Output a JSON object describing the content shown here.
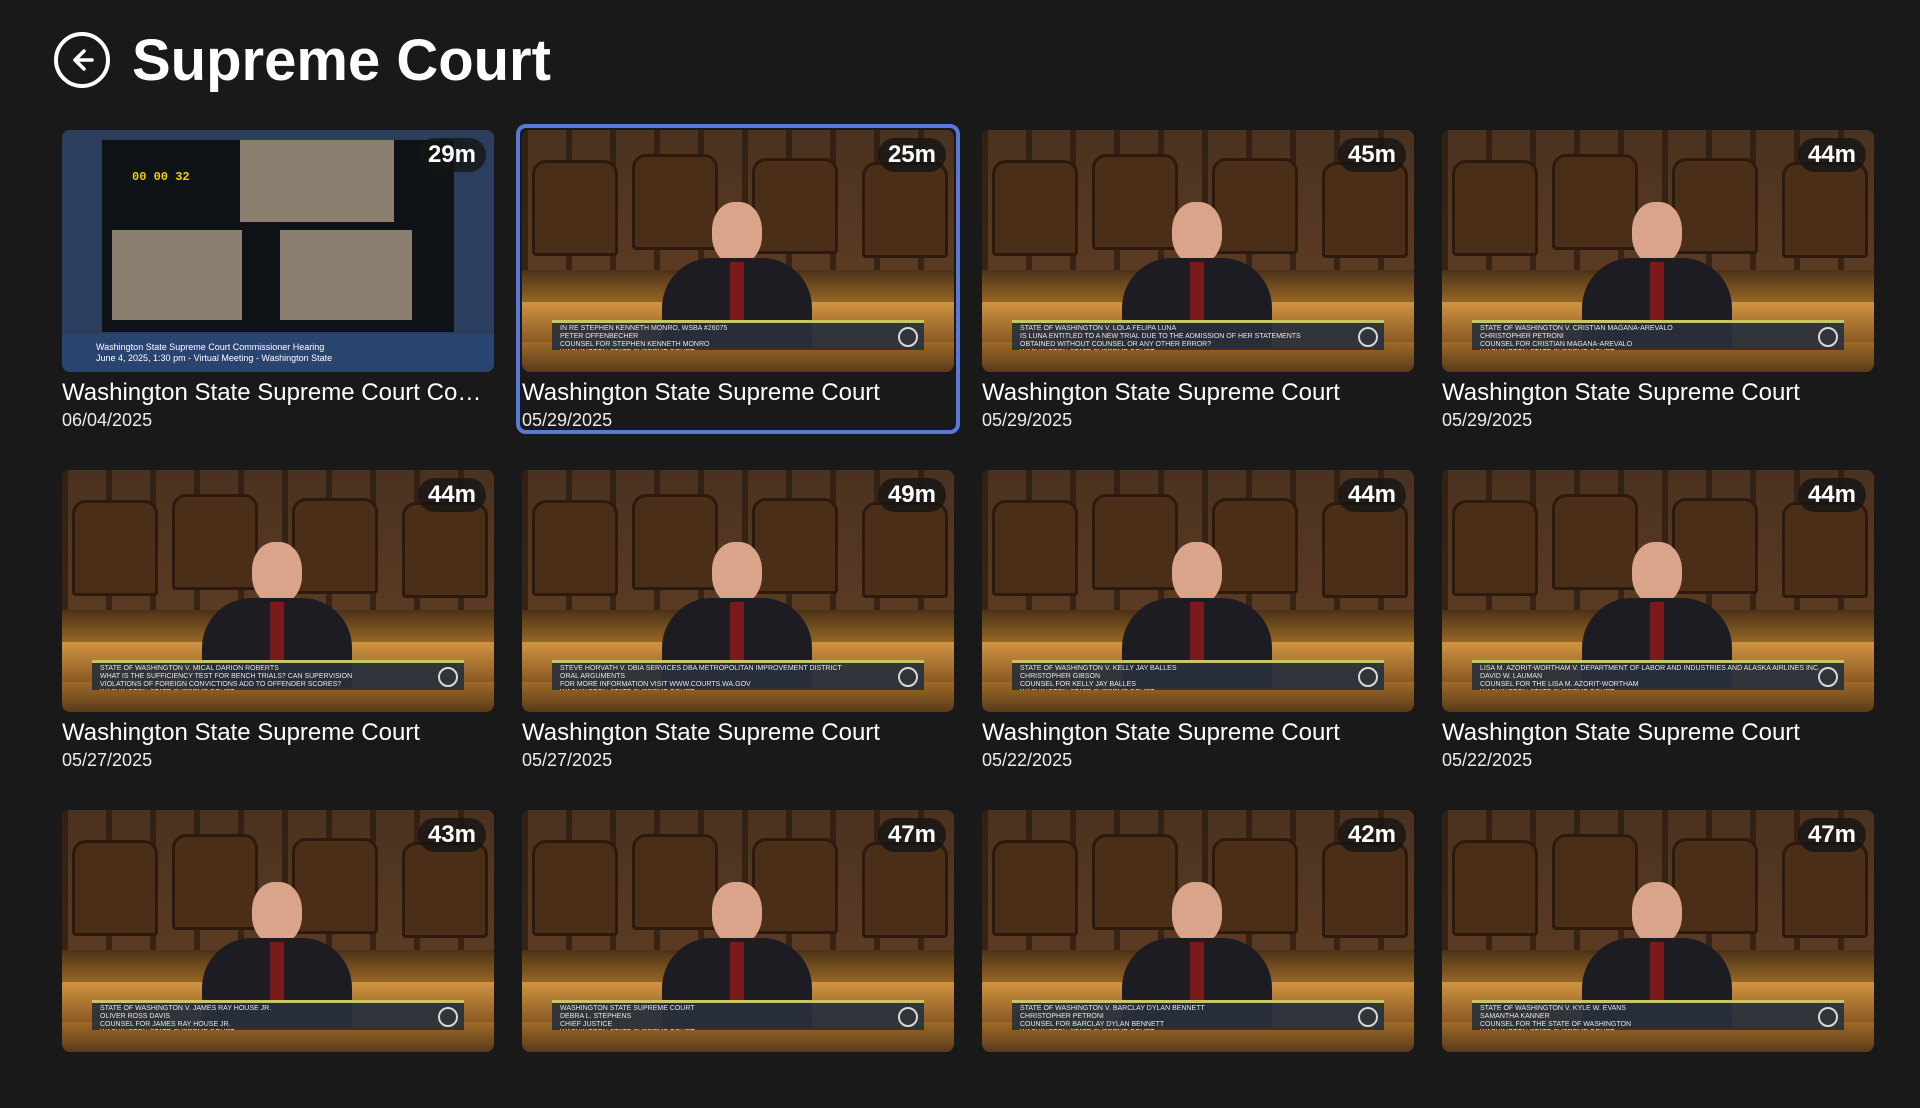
{
  "header": {
    "back_icon": "arrow-left-circle-icon",
    "title": "Supreme Court"
  },
  "colors": {
    "background": "#19191a",
    "focus_ring": "#5a78d6",
    "duration_badge_bg": "#141414"
  },
  "videos": [
    {
      "title": "Washington State Supreme Court Com...",
      "date": "06/04/2025",
      "duration": "29m",
      "thumb_kind": "hearing",
      "clock": "00 00 32",
      "banner_line1": "Washington State Supreme Court Commissioner Hearing",
      "banner_line2": "June 4, 2025, 1:30 pm - Virtual Meeting - Washington State",
      "focused": false
    },
    {
      "title": "Washington State Supreme Court",
      "date": "05/29/2025",
      "duration": "25m",
      "thumb_kind": "court",
      "caption_top": "IN RE STEPHEN KENNETH MONRO, WSBA #26075",
      "caption_line1": "PETER OFFENBECHER",
      "caption_line2": "COUNSEL FOR STEPHEN KENNETH MONRO",
      "caption_line3": "WASHINGTON STATE SUPREME COURT",
      "focused": true
    },
    {
      "title": "Washington State Supreme Court",
      "date": "05/29/2025",
      "duration": "45m",
      "thumb_kind": "court",
      "caption_top": "STATE OF WASHINGTON V. LOLA FELIPA LUNA",
      "caption_line1": "IS LUNA ENTITLED TO A NEW TRIAL DUE TO THE ADMISSION OF HER STATEMENTS",
      "caption_line2": "OBTAINED WITHOUT COUNSEL OR ANY OTHER ERROR?",
      "caption_line3": "WASHINGTON STATE SUPREME COURT",
      "focused": false
    },
    {
      "title": "Washington State Supreme Court",
      "date": "05/29/2025",
      "duration": "44m",
      "thumb_kind": "court",
      "caption_top": "STATE OF WASHINGTON V. CRISTIAN MAGANA-AREVALO",
      "caption_line1": "CHRISTOPHER PETRONI",
      "caption_line2": "COUNSEL FOR CRISTIAN MAGANA-AREVALO",
      "caption_line3": "WASHINGTON STATE SUPREME COURT",
      "focused": false
    },
    {
      "title": "Washington State Supreme Court",
      "date": "05/27/2025",
      "duration": "44m",
      "thumb_kind": "court",
      "caption_top": "STATE OF WASHINGTON V. MICAL DARION ROBERTS",
      "caption_line1": "WHAT IS THE SUFFICIENCY TEST FOR BENCH TRIALS? CAN SUPERVISION",
      "caption_line2": "VIOLATIONS OF FOREIGN CONVICTIONS ADD TO OFFENDER SCORES?",
      "caption_line3": "WASHINGTON STATE SUPREME COURT",
      "focused": false
    },
    {
      "title": "Washington State Supreme Court",
      "date": "05/27/2025",
      "duration": "49m",
      "thumb_kind": "court",
      "caption_top": "STEVE HORVATH V. DBIA SERVICES DBA METROPOLITAN IMPROVEMENT DISTRICT",
      "caption_line1": "ORAL ARGUMENTS",
      "caption_line2": "FOR MORE INFORMATION VISIT WWW.COURTS.WA.GOV",
      "caption_line3": "WASHINGTON STATE SUPREME COURT",
      "focused": false
    },
    {
      "title": "Washington State Supreme Court",
      "date": "05/22/2025",
      "duration": "44m",
      "thumb_kind": "court",
      "caption_top": "STATE OF WASHINGTON V. KELLY JAY BALLES",
      "caption_line1": "CHRISTOPHER GIBSON",
      "caption_line2": "COUNSEL FOR KELLY JAY BALLES",
      "caption_line3": "WASHINGTON STATE SUPREME COURT",
      "focused": false
    },
    {
      "title": "Washington State Supreme Court",
      "date": "05/22/2025",
      "duration": "44m",
      "thumb_kind": "court",
      "caption_top": "LISA M. AZORIT-WORTHAM V. DEPARTMENT OF LABOR AND INDUSTRIES AND ALASKA AIRLINES INC.",
      "caption_line1": "DAVID W. LAUMAN",
      "caption_line2": "COUNSEL FOR THE LISA M. AZORIT-WORTHAM",
      "caption_line3": "WASHINGTON STATE SUPREME COURT",
      "focused": false
    },
    {
      "title": "",
      "date": "",
      "duration": "43m",
      "thumb_kind": "court",
      "caption_top": "STATE OF WASHINGTON V. JAMES RAY HOUSE JR.",
      "caption_line1": "OLIVER ROSS DAVIS",
      "caption_line2": "COUNSEL FOR JAMES RAY HOUSE JR.",
      "caption_line3": "WASHINGTON STATE SUPREME COURT",
      "focused": false
    },
    {
      "title": "",
      "date": "",
      "duration": "47m",
      "thumb_kind": "court",
      "caption_top": "WASHINGTON STATE SUPREME COURT",
      "caption_line1": "DEBRA L. STEPHENS",
      "caption_line2": "CHIEF JUSTICE",
      "caption_line3": "WASHINGTON STATE SUPREME COURT",
      "focused": false
    },
    {
      "title": "",
      "date": "",
      "duration": "42m",
      "thumb_kind": "court",
      "caption_top": "STATE OF WASHINGTON V. BARCLAY DYLAN BENNETT",
      "caption_line1": "CHRISTOPHER PETRONI",
      "caption_line2": "COUNSEL FOR BARCLAY DYLAN BENNETT",
      "caption_line3": "WASHINGTON STATE SUPREME COURT",
      "focused": false
    },
    {
      "title": "",
      "date": "",
      "duration": "47m",
      "thumb_kind": "court",
      "caption_top": "STATE OF WASHINGTON V. KYLE W. EVANS",
      "caption_line1": "SAMANTHA KANNER",
      "caption_line2": "COUNSEL FOR THE STATE OF WASHINGTON",
      "caption_line3": "WASHINGTON STATE SUPREME COURT",
      "focused": false
    }
  ]
}
